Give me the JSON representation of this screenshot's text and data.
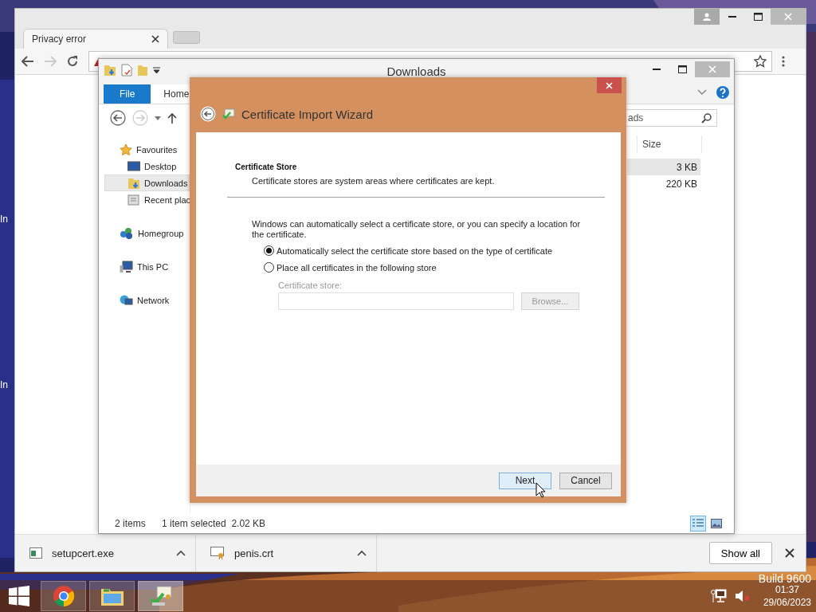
{
  "desktop": {
    "labels": [
      "In",
      "In"
    ],
    "build": "Build 9600"
  },
  "browser": {
    "tabs": [
      {
        "label": "Privacy error",
        "selected": true
      }
    ],
    "downloads": [
      {
        "file": "setupcert.exe",
        "kind": "app"
      },
      {
        "file": "penis.crt",
        "kind": "certificate"
      }
    ],
    "show_all": "Show all"
  },
  "explorer": {
    "title": "Downloads",
    "ribbon_tabs": [
      {
        "label": "File",
        "selected": true
      },
      {
        "label": "Home",
        "selected": false
      }
    ],
    "search": {
      "value": "ads"
    },
    "columns": [
      "Size"
    ],
    "rows": [
      {
        "size": "3 KB",
        "selected": true
      },
      {
        "size": "220 KB",
        "selected": false
      }
    ],
    "sidebar": {
      "items": [
        {
          "label": "Favourites",
          "kind": "star",
          "selected": false,
          "children": [
            {
              "label": "Desktop",
              "kind": "desktop",
              "selected": false
            },
            {
              "label": "Downloads",
              "kind": "downloads",
              "selected": true
            },
            {
              "label": "Recent plac",
              "kind": "recent",
              "selected": false
            }
          ]
        },
        {
          "label": "Homegroup",
          "kind": "homegroup",
          "selected": false
        },
        {
          "label": "This PC",
          "kind": "pc",
          "selected": false
        },
        {
          "label": "Network",
          "kind": "network",
          "selected": false
        }
      ]
    },
    "status_bar": {
      "count": "2 items",
      "selection": "1 item selected  2.02 KB"
    },
    "view_buttons": [
      {
        "kind": "details",
        "selected": true
      },
      {
        "kind": "tiles",
        "selected": false
      }
    ]
  },
  "wizard": {
    "title": "Certificate Import Wizard",
    "heading": "Certificate Store",
    "subheading": "Certificate stores are system areas where certificates are kept.",
    "intro": "Windows can automatically select a certificate store, or you can specify a location for the certificate.",
    "options": [
      {
        "label": "Automatically select the certificate store based on the type of certificate",
        "selected": true
      },
      {
        "label": "Place all certificates in the following store",
        "selected": false
      }
    ],
    "store_label": "Certificate store:",
    "store_disabled": true,
    "browse": {
      "label": "Browse...",
      "disabled": true
    },
    "buttons": [
      {
        "label": "Next",
        "kind": "default"
      },
      {
        "label": "Cancel",
        "kind": "normal"
      }
    ]
  },
  "taskbar": {
    "apps": [
      {
        "kind": "browser",
        "active": false
      },
      {
        "kind": "folder",
        "active": false
      },
      {
        "kind": "certificate",
        "active": true
      }
    ],
    "volume_muted": true,
    "clock": {
      "time": "01:37",
      "date": "29/06/2023"
    }
  }
}
